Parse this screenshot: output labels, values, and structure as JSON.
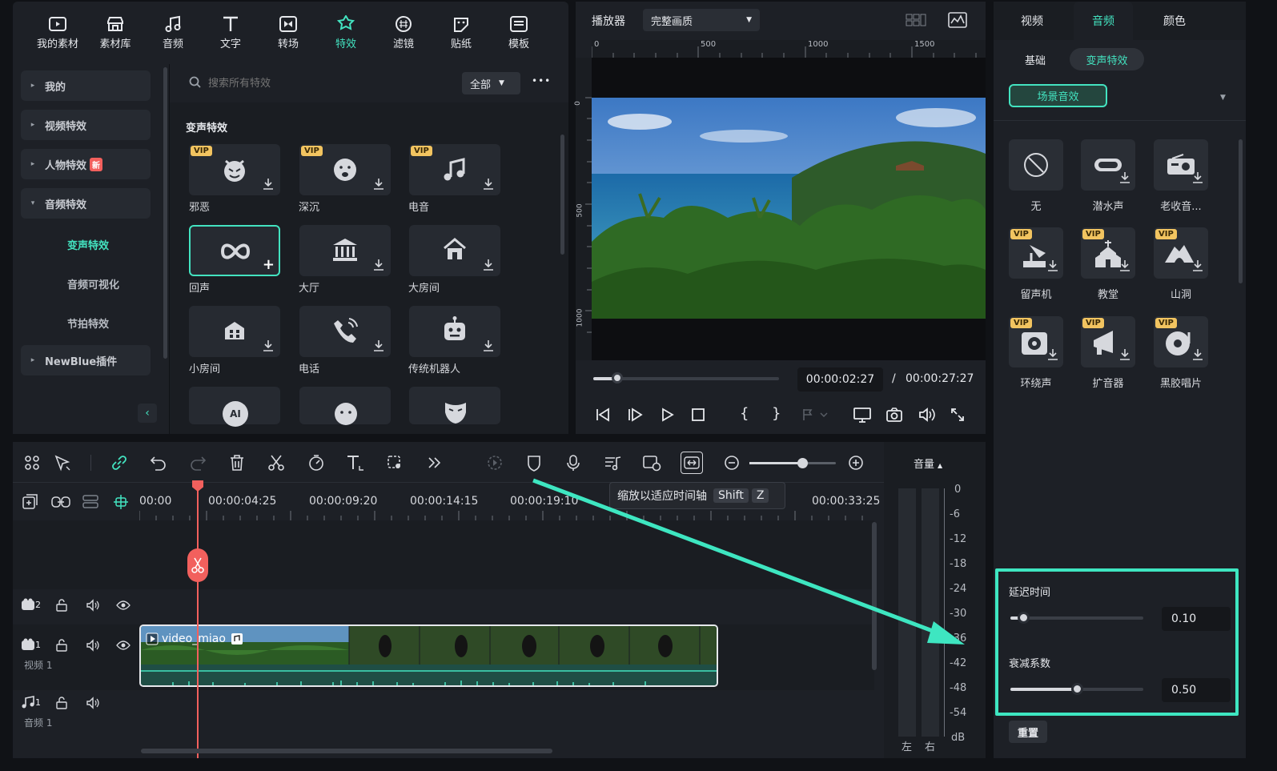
{
  "toolbar": {
    "items": [
      {
        "label": "我的素材",
        "icon": "media-icon"
      },
      {
        "label": "素材库",
        "icon": "store-icon"
      },
      {
        "label": "音频",
        "icon": "music-note-icon"
      },
      {
        "label": "文字",
        "icon": "text-icon"
      },
      {
        "label": "转场",
        "icon": "transition-icon"
      },
      {
        "label": "特效",
        "icon": "effects-icon",
        "active": true
      },
      {
        "label": "滤镜",
        "icon": "filter-icon"
      },
      {
        "label": "贴纸",
        "icon": "sticker-icon"
      },
      {
        "label": "模板",
        "icon": "template-icon"
      }
    ]
  },
  "categories": {
    "items": [
      "我的",
      "视频特效",
      "人物特效",
      "音频特效",
      "NewBlue插件"
    ],
    "new_badge": "新",
    "subitems": [
      "变声特效",
      "音频可视化",
      "节拍特效"
    ]
  },
  "search": {
    "placeholder": "搜索所有特效",
    "filter_value": "全部",
    "more": "•••"
  },
  "effects": {
    "section_title": "变声特效",
    "vip_badge": "VIP",
    "items": [
      "邪恶",
      "深沉",
      "电音",
      "回声",
      "大厅",
      "大房间",
      "小房间",
      "电话",
      "传统机器人"
    ]
  },
  "player": {
    "label": "播放器",
    "quality": "完整画质",
    "ruler_h": [
      "0",
      "500",
      "1000",
      "1500"
    ],
    "ruler_v": [
      "0",
      "500",
      "1000"
    ],
    "current_time": "00:00:02:27",
    "separator": "/",
    "total_time": "00:00:27:27",
    "progress": 0.13
  },
  "right_panel": {
    "tabs": [
      "视频",
      "音频",
      "颜色"
    ],
    "subtabs": [
      "基础",
      "变声特效"
    ],
    "dropdown_value": "场景音效",
    "vip_badge": "VIP",
    "sfx": [
      "无",
      "潜水声",
      "老收音...",
      "留声机",
      "教堂",
      "山洞",
      "环绕声",
      "扩音器",
      "黑胶唱片"
    ],
    "delay_label": "延迟时间",
    "delay_value": "0.10",
    "delay_level": 0.1,
    "decay_label": "衰减系数",
    "decay_value": "0.50",
    "decay_level": 0.5,
    "reset_label": "重置"
  },
  "timeline": {
    "ruler": [
      "00:00",
      "00:00:04:25",
      "00:00:09:20",
      "00:00:14:15",
      "00:00:19:10",
      "00:00:33:25"
    ],
    "tooltip_text": "缩放以适应时间轴",
    "tooltip_key1": "Shift",
    "tooltip_key2": "Z",
    "track2_num": "2",
    "track1_num": "1",
    "track1_label": "视频 1",
    "audio_num": "1",
    "audio_label": "音频 1",
    "clip_name": "video_miao",
    "zoom_level": 0.62,
    "volume_label": "音量",
    "meter_scale": [
      "0",
      "-6",
      "-12",
      "-18",
      "-24",
      "-30",
      "-36",
      "-42",
      "-48",
      "-54",
      "dB"
    ],
    "meter_channels": [
      "左",
      "右"
    ]
  },
  "colors": {
    "accent": "#43e3c0",
    "vip": "#f2c460",
    "playhead": "#f2605d",
    "highlight_box": "#3ee6c1"
  }
}
